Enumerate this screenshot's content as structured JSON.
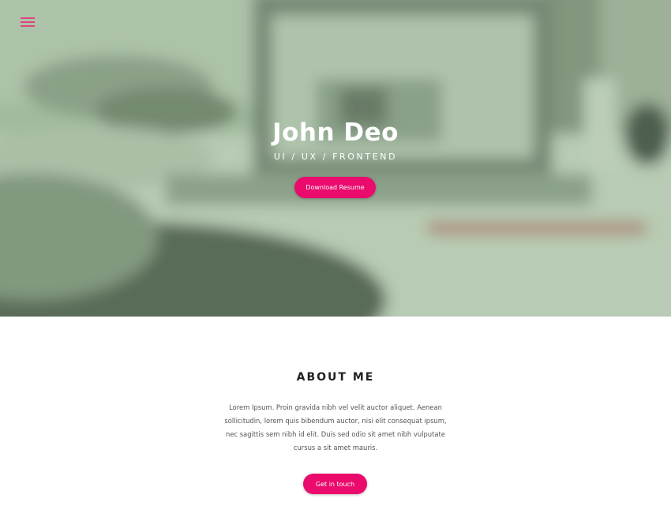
{
  "hero": {
    "name": "John Deo",
    "subtitle": "UI / UX / FRONTEND",
    "resume_button": "Download Resume"
  },
  "nav": {
    "menu_icon": "hamburger-menu-icon",
    "menu_icon_color": "#e0457e"
  },
  "about": {
    "title": "ABOUT ME",
    "text": "Lorem Ipsum. Proin gravida nibh vel velit auctor aliquet. Aenean sollicitudin, lorem quis bibendum auctor, nisi elit consequat ipsum, nec sagittis sem nibh id elit. Duis sed odio sit amet nibh vulputate cursus a sit amet mauris.",
    "contact_button": "Get in touch"
  },
  "colors": {
    "accent": "#ea0b6c",
    "hero_overlay": "#8fae8c"
  }
}
